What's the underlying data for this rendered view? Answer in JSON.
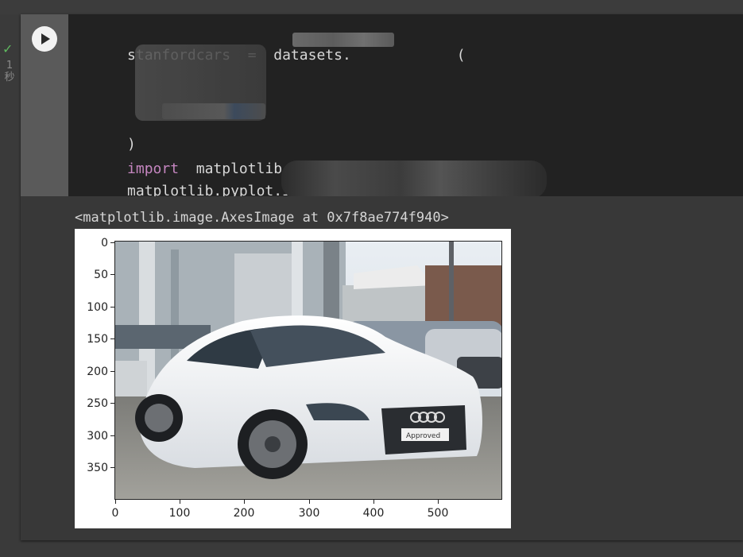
{
  "cell": {
    "status_icon": "check-icon",
    "exec_time": "1\n秒",
    "run_icon": "play-icon",
    "code_lines": [
      "stanfordcars  =  datasets.",
      "(",
      ")",
      "import",
      "  matplotlib",
      "matplotlib.pyplot.imshow"
    ]
  },
  "output": {
    "text": "<matplotlib.image.AxesImage at 0x7f8ae774f940>"
  },
  "plot": {
    "yticks": [
      "0",
      "50",
      "100",
      "150",
      "200",
      "250",
      "300",
      "350"
    ],
    "xticks": [
      "0",
      "100",
      "200",
      "300",
      "400",
      "500"
    ],
    "image_label": "Approved"
  },
  "colors": {
    "accent_run": "#f2f2f2",
    "keyword": "#c586c0",
    "check": "#5fb95f"
  }
}
